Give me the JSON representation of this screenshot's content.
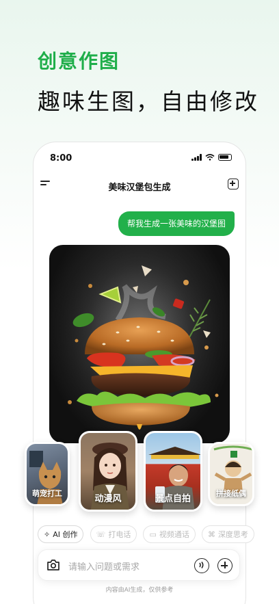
{
  "promo": {
    "headline": "创意作图",
    "subheadline": "趣味生图，自由修改"
  },
  "status_bar": {
    "time": "8:00"
  },
  "nav": {
    "title": "美味汉堡包生成",
    "menu_icon": "menu-icon",
    "new_chat_icon": "new-chat-icon"
  },
  "chat": {
    "user_message": "帮我生成一张美味的汉堡图"
  },
  "styles": [
    {
      "label": "萌宠打工"
    },
    {
      "label": "动漫风"
    },
    {
      "label": "景点自拍"
    },
    {
      "label": "拼接纸偶"
    }
  ],
  "tools": [
    {
      "label": "AI 创作",
      "icon": "sparkle-icon"
    },
    {
      "label": "打电话",
      "icon": "phone-icon"
    },
    {
      "label": "视频通话",
      "icon": "video-icon"
    },
    {
      "label": "深度思考",
      "icon": "think-icon"
    }
  ],
  "input": {
    "placeholder": "请输入问题或需求"
  },
  "footer": {
    "disclaimer": "内容由AI生成，仅供参考"
  },
  "colors": {
    "accent": "#22b04a"
  }
}
